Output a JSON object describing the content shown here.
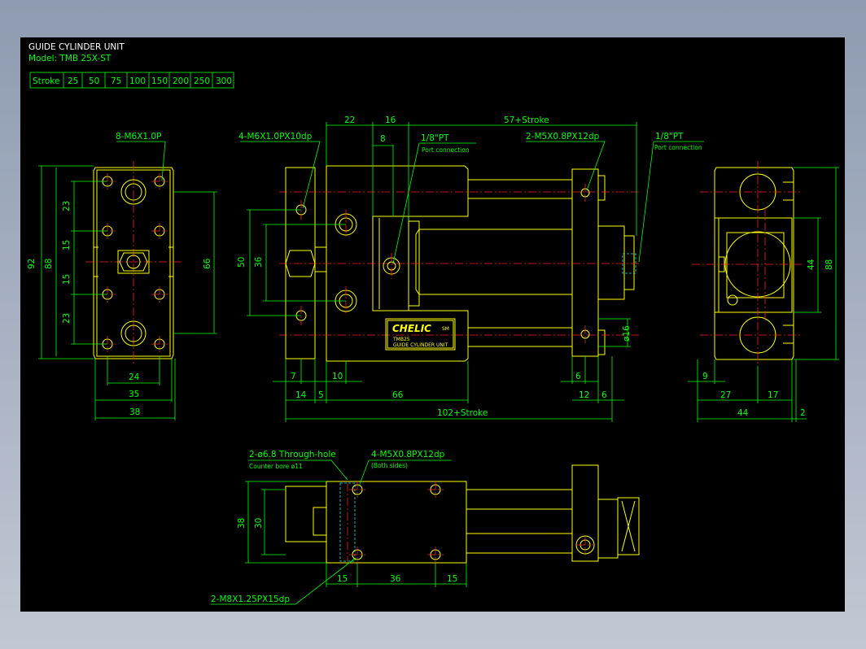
{
  "title": "GUIDE CYLINDER UNIT",
  "model": "Model: TMB 25X-ST",
  "stroke_table": {
    "header": "Stroke",
    "values": [
      "25",
      "50",
      "75",
      "100",
      "150",
      "200",
      "250",
      "300"
    ]
  },
  "left_view": {
    "callout": "8-M6X1.0P",
    "dims": {
      "height_92": "92",
      "height_88": "88",
      "d23_top": "23",
      "d15_top": "15",
      "d15_bot": "15",
      "d23_bot": "23",
      "height_66": "66",
      "w24": "24",
      "w35": "35",
      "w38": "38"
    }
  },
  "front_view": {
    "callout_tap": "4-M6X1.0PX10dp",
    "callout_pt": "1/8\"PT",
    "callout_port": "Port connection",
    "callout_m5": "2-M5X0.8PX12dp",
    "brand": "CHELIC",
    "brand_sub": "SM",
    "plate_model": "TMB25",
    "plate_name": "GUIDE CYLINDER UNIT",
    "dims": {
      "d22": "22",
      "d16": "16",
      "d8": "8",
      "d57": "57+Stroke",
      "d50": "50",
      "d36": "36",
      "dia16": "ø16",
      "d7": "7",
      "d10": "10",
      "d14": "14",
      "d5": "5",
      "d66": "66",
      "d6a": "6",
      "d12": "12",
      "d6b": "6",
      "d102": "102+Stroke"
    }
  },
  "right_view": {
    "callout_pt": "1/8\"PT",
    "callout_port": "Port connection",
    "dims": {
      "d44v": "44",
      "d88": "88",
      "d9": "9",
      "d27": "27",
      "d17": "17",
      "d44": "44",
      "d2": "2"
    }
  },
  "bottom_view": {
    "callout_hole": "2-ø6.8 Through-hole",
    "callout_bore": "Counter bore ø11",
    "callout_m5": "4-M5X0.8PX12dp",
    "callout_both": "(Both sides)",
    "callout_m8": "2-M8X1.25PX15dp",
    "dims": {
      "d38": "38",
      "d30": "30",
      "d15a": "15",
      "d36": "36",
      "d15b": "15"
    }
  },
  "colors": {
    "outline": "#ffff00",
    "dimension": "#00ff00",
    "centerline": "#ff2020",
    "hidden": "#00e5ff",
    "background": "#000000",
    "window": "#9aa6b8"
  }
}
